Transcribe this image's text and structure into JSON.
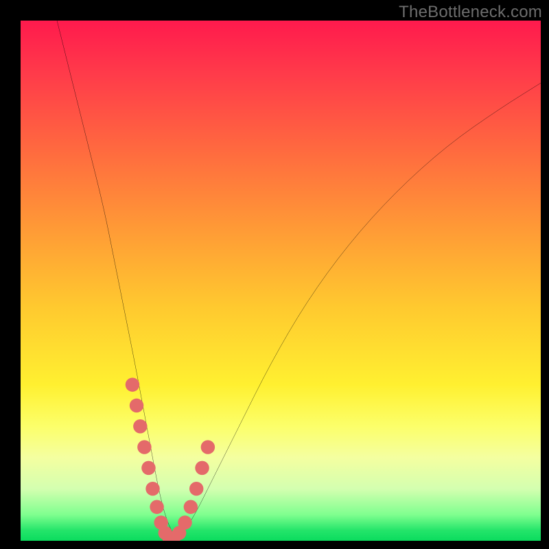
{
  "watermark": {
    "text": "TheBottleneck.com"
  },
  "chart_data": {
    "type": "line",
    "title": "",
    "xlabel": "",
    "ylabel": "",
    "xlim": [
      0,
      100
    ],
    "ylim": [
      0,
      100
    ],
    "background_gradient": {
      "orientation": "vertical",
      "stops": [
        {
          "pos": 0,
          "color": "#ff1a4d"
        },
        {
          "pos": 55,
          "color": "#ffc92f"
        },
        {
          "pos": 78,
          "color": "#fcff6a"
        },
        {
          "pos": 95,
          "color": "#7fff8f"
        },
        {
          "pos": 100,
          "color": "#0bdc5e"
        }
      ]
    },
    "series": [
      {
        "name": "bottleneck-curve",
        "color": "#000000",
        "x": [
          7,
          10,
          13,
          16,
          18,
          20,
          22,
          23.5,
          25,
          26.5,
          28,
          30,
          33,
          37,
          42,
          48,
          55,
          63,
          72,
          82,
          92,
          100
        ],
        "y": [
          100,
          88,
          76,
          64,
          54,
          44,
          34,
          26,
          18,
          10,
          4,
          0,
          4,
          12,
          22,
          34,
          46,
          57,
          67,
          76,
          83,
          88
        ]
      },
      {
        "name": "highlight-dots",
        "color": "#e46a6a",
        "marker": "round",
        "x": [
          21.5,
          22.3,
          23.0,
          23.8,
          24.6,
          25.4,
          26.2,
          27.0,
          27.8,
          28.6,
          29.4,
          30.5,
          31.6,
          32.7,
          33.8,
          34.9,
          36.0
        ],
        "y": [
          30.0,
          26.0,
          22.0,
          18.0,
          14.0,
          10.0,
          6.5,
          3.5,
          1.5,
          0.5,
          0.5,
          1.5,
          3.5,
          6.5,
          10.0,
          14.0,
          18.0
        ]
      }
    ]
  }
}
